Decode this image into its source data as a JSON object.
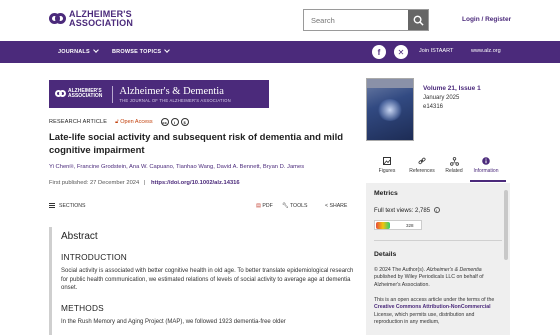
{
  "header": {
    "logo_line1": "ALZHEIMER'S",
    "logo_line2": "ASSOCIATION",
    "search_placeholder": "Search",
    "login_label": "Login / Register"
  },
  "nav": {
    "journals_label": "JOURNALS",
    "browse_label": "BROWSE TOPICS",
    "istaart_label": "Join ISTAART",
    "alz_label": "www.alz.org"
  },
  "banner": {
    "logo_line1": "ALZHEIMER'S",
    "logo_line2": "ASSOCIATION",
    "journal_name": "Alzheimer's & Dementia",
    "journal_tagline": "THE JOURNAL OF THE ALZHEIMER'S ASSOCIATION"
  },
  "article": {
    "type": "RESEARCH ARTICLE",
    "open_access": "Open Access",
    "cc_icons": [
      "cc",
      "by",
      "nc"
    ],
    "title": "Late-life social activity and subsequent risk of dementia and mild cognitive impairment",
    "authors_first": "Yi Chen",
    "authors_rest": ", Francine Grodstein, Ana W. Capuano, Tianhao Wang, David A. Bennett, Bryan D. James",
    "published_label": "First published:",
    "published_date": "27 December 2024",
    "separator": "|",
    "doi": "https://doi.org/10.1002/alz.14316"
  },
  "toolbar": {
    "sections": "SECTIONS",
    "pdf": "PDF",
    "tools": "TOOLS",
    "share": "SHARE"
  },
  "abstract": {
    "heading": "Abstract",
    "intro_heading": "INTRODUCTION",
    "intro_text": "Social activity is associated with better cognitive health in old age. To better translate epidemiological research for public health communication, we estimated relations of levels of social activity to average age at dementia onset.",
    "methods_heading": "METHODS",
    "methods_text": "In the Rush Memory and Aging Project (MAP), we followed 1923 dementia-free older"
  },
  "issue": {
    "volume": "Volume 21, Issue 1",
    "date": "January 2025",
    "number": "e14316"
  },
  "tabs": [
    {
      "label": "Figures",
      "icon": "image-icon"
    },
    {
      "label": "References",
      "icon": "link-icon"
    },
    {
      "label": "Related",
      "icon": "network-icon"
    },
    {
      "label": "Information",
      "icon": "info-icon"
    }
  ],
  "panel": {
    "metrics_heading": "Metrics",
    "views_label": "Full text views:",
    "views_value": "2,785",
    "altmetric_score": "328",
    "details_heading": "Details",
    "copyright_prefix": "© 2024 The Author(s).",
    "copyright_journal": "Alzheimer's & Dementia",
    "copyright_suffix": "published by Wiley Periodicals LLC on behalf of Alzheimer's Association.",
    "oa_text_1": "This is an open access article under the terms of the",
    "oa_license": "Creative Commons Attribution-NonCommercial",
    "oa_text_2": "License, which permits use, distribution and reproduction in any medium,"
  },
  "colors": {
    "brand_purple": "#4b2a7b",
    "open_access": "#c2410c"
  }
}
